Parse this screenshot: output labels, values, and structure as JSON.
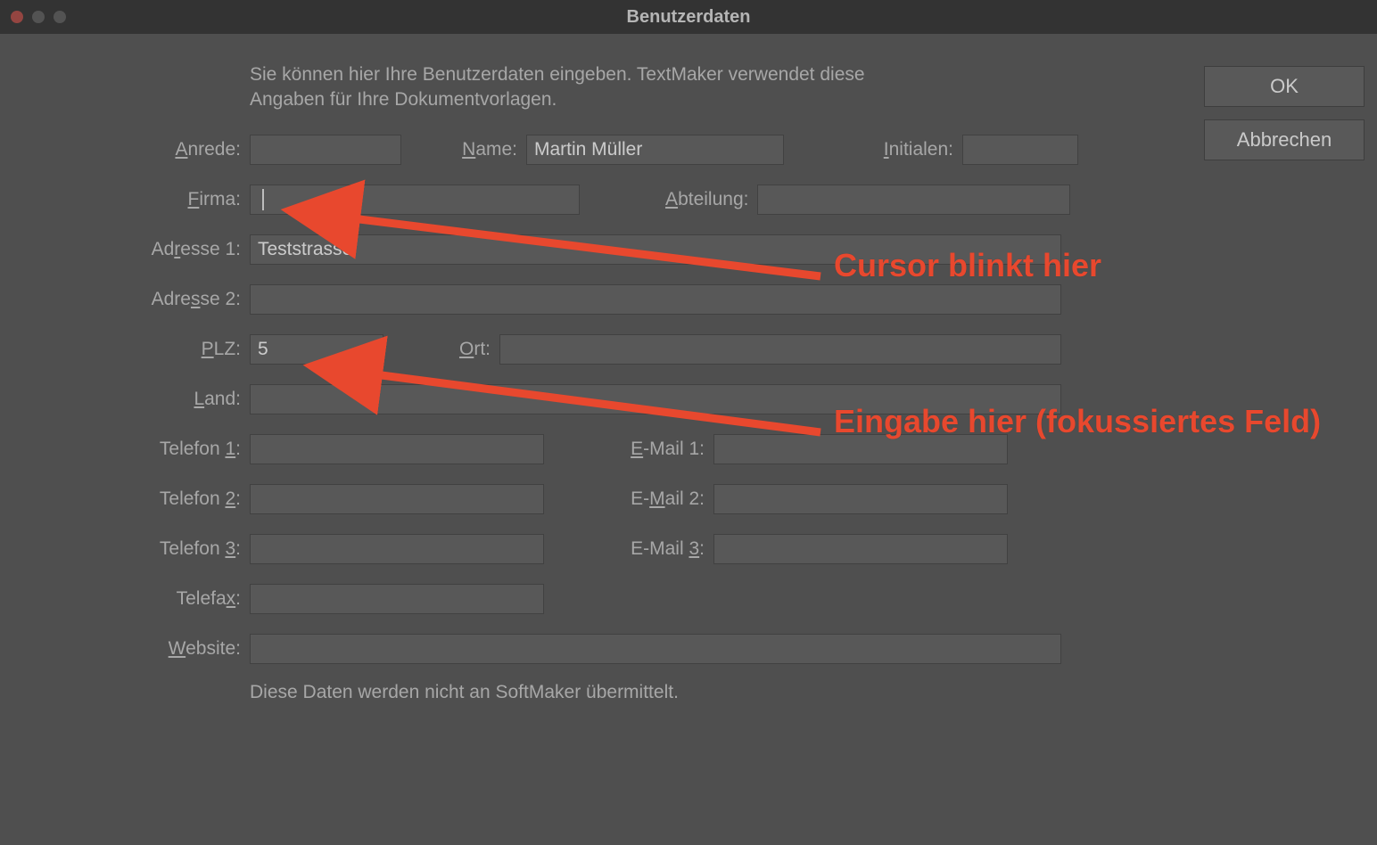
{
  "window": {
    "title": "Benutzerdaten"
  },
  "intro": "Sie können hier Ihre Benutzerdaten eingeben. TextMaker verwendet diese Angaben für Ihre Dokumentvorlagen.",
  "labels": {
    "anrede": "nrede:",
    "name": "ame:",
    "initialen": "nitialen:",
    "firma": "irma:",
    "abteilung": "bteilung:",
    "adresse1a": "Ad",
    "adresse1b": "esse 1:",
    "adresse2a": "Adre",
    "adresse2b": "se 2:",
    "plz": "LZ:",
    "ort": "rt:",
    "land": "and:",
    "tel1": "Telefon ",
    "tel2": "Telefon ",
    "tel3": "Telefon ",
    "telefax": "Telefa",
    "mail1": "-Mail 1:",
    "mail2": "E-",
    "mail2b": "ail 2:",
    "mail3": "E-Mail ",
    "website": "ebsite:"
  },
  "accel": {
    "anrede": "A",
    "name": "N",
    "initialen": "I",
    "firma": "F",
    "abteilung": "A",
    "adresse1": "r",
    "adresse2": "s",
    "plz": "P",
    "ort": "O",
    "land": "L",
    "tel1": "1",
    "tel2": "2",
    "tel3": "3",
    "telefax": "x",
    "mail1": "E",
    "mail2": "M",
    "mail3": "3",
    "website": "W"
  },
  "values": {
    "anrede": "",
    "name": "Martin Müller",
    "initialen": "",
    "firma": "",
    "abteilung": "",
    "adresse1": "Teststrasse",
    "adresse2": "",
    "plz": "5",
    "ort": "",
    "land": "",
    "tel1": "",
    "tel2": "",
    "tel3": "",
    "telefax": "",
    "mail1": "",
    "mail2": "",
    "mail3": "",
    "website": ""
  },
  "footnote": "Diese Daten werden nicht an SoftMaker übermittelt.",
  "buttons": {
    "ok": "OK",
    "cancel": "Abbrechen"
  },
  "annotations": {
    "a1": "Cursor blinkt hier",
    "a2": "Eingabe hier (fokussiertes Feld)"
  }
}
